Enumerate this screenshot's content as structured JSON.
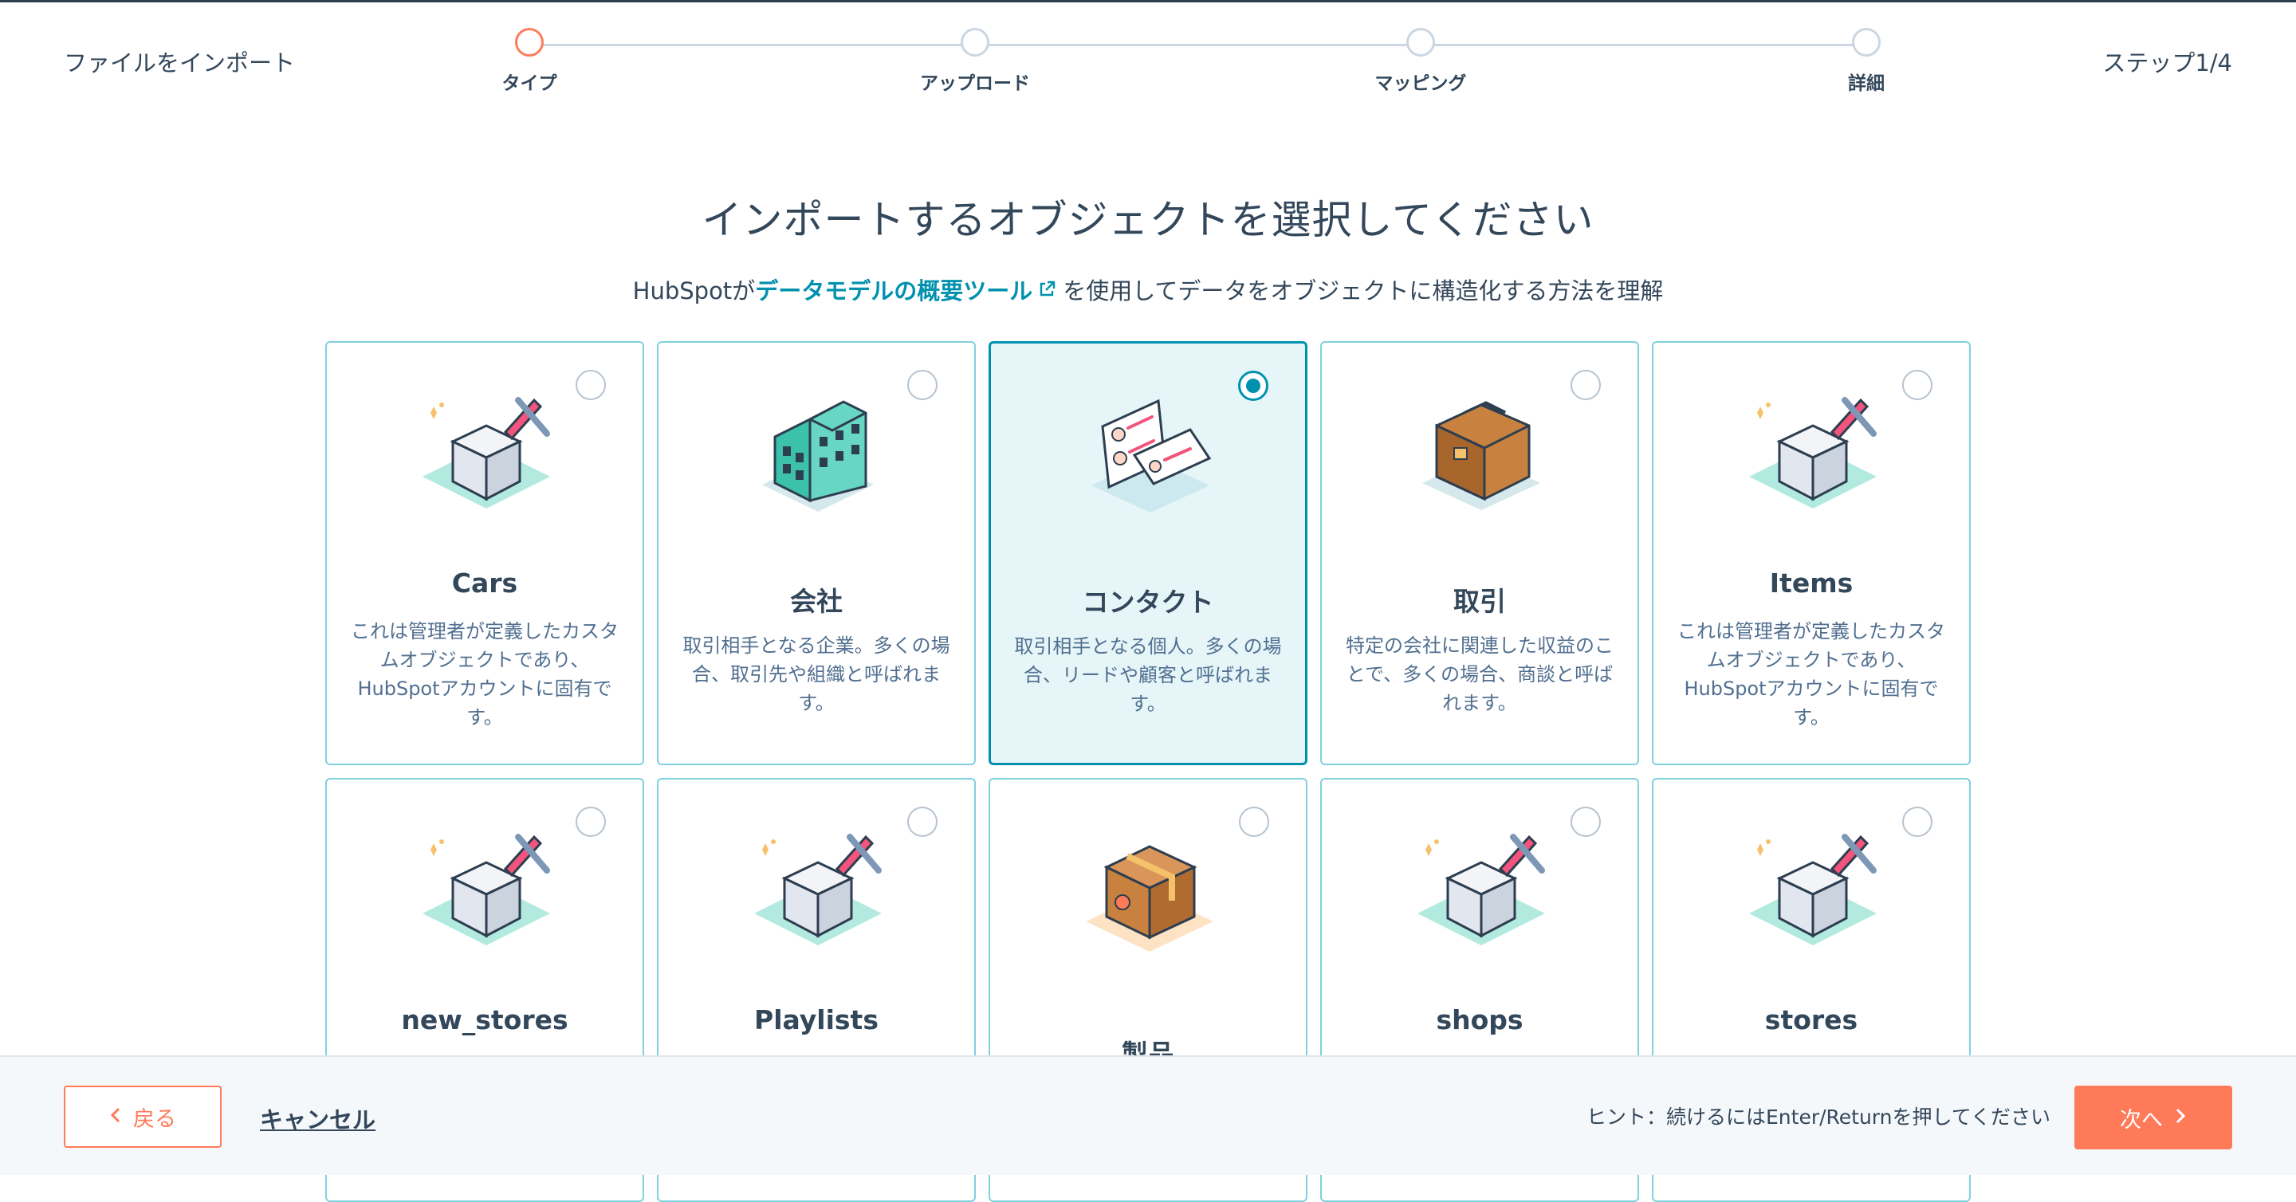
{
  "header": {
    "title": "ファイルをインポート",
    "step_count": "ステップ1/4",
    "steps": [
      {
        "label": "タイプ",
        "active": true
      },
      {
        "label": "アップロード",
        "active": false
      },
      {
        "label": "マッピング",
        "active": false
      },
      {
        "label": "詳細",
        "active": false
      }
    ]
  },
  "main": {
    "heading": "インポートするオブジェクトを選択してください",
    "sub_prefix": "HubSpotが",
    "sub_link": "データモデルの概要ツール",
    "sub_suffix": "を使用してデータをオブジェクトに構造化する方法を理解"
  },
  "cards": [
    {
      "name": "Cars",
      "desc": "これは管理者が定義したカスタムオブジェクトであり、HubSpotアカウントに固有です。",
      "icon": "custom-object-icon",
      "selected": false
    },
    {
      "name": "会社",
      "desc": "取引相手となる企業。多くの場合、取引先や組織と呼ばれます。",
      "icon": "company-building-icon",
      "selected": false
    },
    {
      "name": "コンタクト",
      "desc": "取引相手となる個人。多くの場合、リードや顧客と呼ばれます。",
      "icon": "contact-card-icon",
      "selected": true
    },
    {
      "name": "取引",
      "desc": "特定の会社に関連した収益のことで、多くの場合、商談と呼ばれます。",
      "icon": "deal-briefcase-icon",
      "selected": false
    },
    {
      "name": "Items",
      "desc": "これは管理者が定義したカスタムオブジェクトであり、HubSpotアカウントに固有です。",
      "icon": "custom-object-icon",
      "selected": false
    },
    {
      "name": "new_stores",
      "desc": "",
      "icon": "custom-object-icon",
      "selected": false
    },
    {
      "name": "Playlists",
      "desc": "",
      "icon": "custom-object-icon",
      "selected": false
    },
    {
      "name": "製品",
      "desc": "",
      "icon": "product-box-icon",
      "selected": false
    },
    {
      "name": "shops",
      "desc": "",
      "icon": "custom-object-icon",
      "selected": false
    },
    {
      "name": "stores",
      "desc": "",
      "icon": "custom-object-icon",
      "selected": false
    }
  ],
  "footer": {
    "back_label": "戻る",
    "cancel_label": "キャンセル",
    "hint": "ヒント：続けるにはEnter/Returnを押してください",
    "next_label": "次へ"
  },
  "colors": {
    "accent": "#ff7a59",
    "selected_border": "#0091ae",
    "selected_bg": "#e5f5f8",
    "card_border": "#7fd1de",
    "text": "#33475b"
  }
}
